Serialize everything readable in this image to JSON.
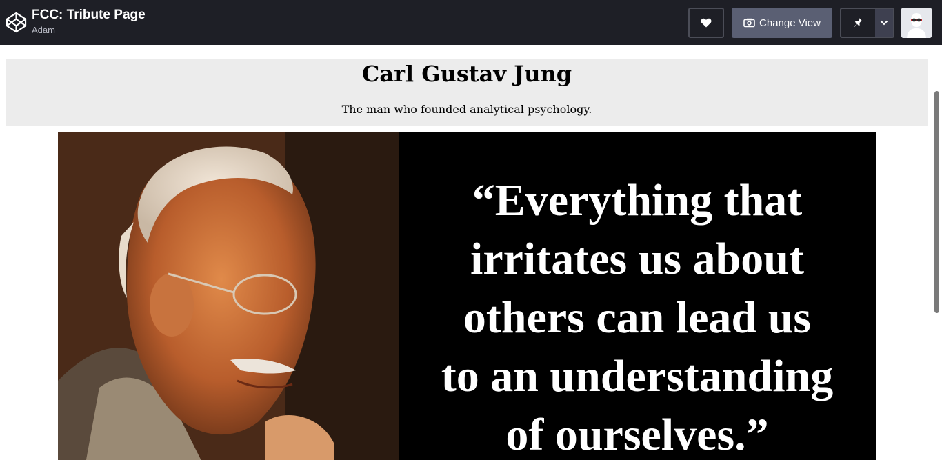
{
  "header": {
    "pen_title": "FCC: Tribute Page",
    "author": "Adam",
    "change_view_label": "Change View"
  },
  "icons": {
    "logo": "codepen-logo-icon",
    "heart": "heart-icon",
    "change_view": "camera-view-icon",
    "pin": "pin-icon",
    "dropdown": "chevron-down-icon",
    "avatar": "user-avatar"
  },
  "tribute": {
    "title": "Carl Gustav Jung",
    "subtitle": "The man who founded analytical psychology.",
    "quote_lines": [
      "“Everything that",
      "irritates us about",
      "others can lead us",
      "to an understanding",
      "of ourselves.”"
    ]
  },
  "colors": {
    "topbar_bg": "#1e1f26",
    "button_bg": "#5a5f73",
    "header_box_bg": "#ececec",
    "quote_bg": "#000000"
  }
}
